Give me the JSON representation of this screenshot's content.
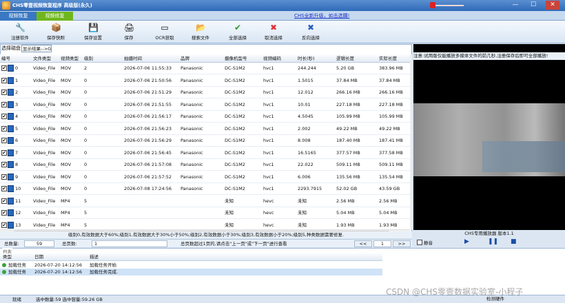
{
  "window": {
    "title": "CHS零壹视频恢复程序 高级版(永久)",
    "minimize": "—",
    "maximize": "☐",
    "close": "✕"
  },
  "tabs": [
    "视频恢复",
    "视频修复"
  ],
  "promo_link": "CHS全新升级，如击选購!",
  "toolbar": [
    {
      "label": "注册软件",
      "icon": "register-icon",
      "glyph": "🔧"
    },
    {
      "label": "保存快照",
      "icon": "snapshot-icon",
      "glyph": "📦"
    },
    {
      "label": "保存设置",
      "icon": "settings-save-icon",
      "glyph": "💾"
    },
    {
      "label": "保存",
      "icon": "save-icon",
      "glyph": "🖨"
    },
    {
      "label": "OCR获取",
      "icon": "ocr-icon",
      "glyph": "▭"
    },
    {
      "label": "搜索文件",
      "icon": "search-file-icon",
      "glyph": "📂"
    },
    {
      "label": "全部选择",
      "icon": "select-all-icon",
      "glyph": "✔"
    },
    {
      "label": "取消选择",
      "icon": "deselect-icon",
      "glyph": "✖"
    },
    {
      "label": "反向选择",
      "icon": "invert-select-icon",
      "glyph": "✖"
    }
  ],
  "left": {
    "disk_tab": "选择磁盘",
    "path_value": "显示结果-->G:"
  },
  "columns": [
    "编号",
    "文件类型",
    "视频类型",
    "级别",
    "拍摄时间",
    "品牌",
    "摄像机型号",
    "视频编码",
    "时长(秒)",
    "逻辑长度",
    "实际长度"
  ],
  "rows": [
    {
      "id": "0",
      "ftype": "Video_File",
      "vtype": "MOV",
      "level": "2",
      "time": "2026-07-06 11:55:33",
      "brand": "Panasonic",
      "model": "DC-S1M2",
      "codec": "hvc1",
      "duration": "244.244",
      "logical": "5.20 GB",
      "actual": "383.96 MB"
    },
    {
      "id": "1",
      "ftype": "Video_File",
      "vtype": "MOV",
      "level": "0",
      "time": "2026-07-06 21:50:56",
      "brand": "Panasonic",
      "model": "DC-S1M2",
      "codec": "hvc1",
      "duration": "1.5015",
      "logical": "37.84 MB",
      "actual": "37.84 MB"
    },
    {
      "id": "2",
      "ftype": "Video_File",
      "vtype": "MOV",
      "level": "0",
      "time": "2026-07-06 21:51:29",
      "brand": "Panasonic",
      "model": "DC-S1M2",
      "codec": "hvc1",
      "duration": "12.012",
      "logical": "266.16 MB",
      "actual": "266.16 MB"
    },
    {
      "id": "3",
      "ftype": "Video_File",
      "vtype": "MOV",
      "level": "0",
      "time": "2026-07-06 21:51:55",
      "brand": "Panasonic",
      "model": "DC-S1M2",
      "codec": "hvc1",
      "duration": "10.01",
      "logical": "227.18 MB",
      "actual": "227.18 MB"
    },
    {
      "id": "4",
      "ftype": "Video_File",
      "vtype": "MOV",
      "level": "0",
      "time": "2026-07-06 21:56:17",
      "brand": "Panasonic",
      "model": "DC-S1M2",
      "codec": "hvc1",
      "duration": "4.5045",
      "logical": "105.99 MB",
      "actual": "105.99 MB"
    },
    {
      "id": "5",
      "ftype": "Video_File",
      "vtype": "MOV",
      "level": "0",
      "time": "2026-07-06 21:56:23",
      "brand": "Panasonic",
      "model": "DC-S1M2",
      "codec": "hvc1",
      "duration": "2.002",
      "logical": "49.22 MB",
      "actual": "49.22 MB"
    },
    {
      "id": "6",
      "ftype": "Video_File",
      "vtype": "MOV",
      "level": "0",
      "time": "2026-07-06 21:56:29",
      "brand": "Panasonic",
      "model": "DC-S1M2",
      "codec": "hvc1",
      "duration": "8.008",
      "logical": "187.40 MB",
      "actual": "187.41 MB"
    },
    {
      "id": "7",
      "ftype": "Video_File",
      "vtype": "MOV",
      "level": "0",
      "time": "2026-07-06 21:56:45",
      "brand": "Panasonic",
      "model": "DC-S1M2",
      "codec": "hvc1",
      "duration": "16.5165",
      "logical": "377.57 MB",
      "actual": "377.58 MB"
    },
    {
      "id": "8",
      "ftype": "Video_File",
      "vtype": "MOV",
      "level": "0",
      "time": "2026-07-06 21:57:08",
      "brand": "Panasonic",
      "model": "DC-S1M2",
      "codec": "hvc1",
      "duration": "22.022",
      "logical": "509.11 MB",
      "actual": "509.11 MB"
    },
    {
      "id": "9",
      "ftype": "Video_File",
      "vtype": "MOV",
      "level": "0",
      "time": "2026-07-06 21:57:52",
      "brand": "Panasonic",
      "model": "DC-S1M2",
      "codec": "hvc1",
      "duration": "6.006",
      "logical": "135.56 MB",
      "actual": "135.54 MB"
    },
    {
      "id": "10",
      "ftype": "Video_File",
      "vtype": "MOV",
      "level": "0",
      "time": "2026-07-08 17:24:56",
      "brand": "Panasonic",
      "model": "DC-S1M2",
      "codec": "hvc1",
      "duration": "2293.7915",
      "logical": "52.02 GB",
      "actual": "43.59 GB"
    },
    {
      "id": "11",
      "ftype": "Video_File",
      "vtype": "MP4",
      "level": "5",
      "time": "",
      "brand": "",
      "model": "未知",
      "codec": "hevc",
      "duration": "未知",
      "logical": "2.56 MB",
      "actual": "2.56 MB"
    },
    {
      "id": "12",
      "ftype": "Video_File",
      "vtype": "MP4",
      "level": "5",
      "time": "",
      "brand": "",
      "model": "未知",
      "codec": "hevc",
      "duration": "未知",
      "logical": "5.04 MB",
      "actual": "5.04 MB"
    },
    {
      "id": "13",
      "ftype": "Video_File",
      "vtype": "MP4",
      "level": "5",
      "time": "",
      "brand": "",
      "model": "未知",
      "codec": "hevc",
      "duration": "未知",
      "logical": "1.93 MB",
      "actual": "1.93 MB"
    }
  ],
  "level_note": "级别0,有效数据大于60%;级别1,有效数据大于30%小于50%;级别2,有效数据小于30%;级别3,有效数据小于20%;级别5,种类数据需要修复.",
  "status_row": {
    "total_label": "总数量:",
    "total_value": "59",
    "pages_label": "总页数:",
    "pages_value": "1",
    "hint": "总页数超过1页的,请点击\"上一页\"或\"下一页\"进行查看",
    "prev": "<<",
    "page_value": "1",
    "next": ">>"
  },
  "player": {
    "notice": "注意:试用版仅能播放多媒体文件的前几秒,注册保存后即可全部播放!",
    "title": "CHS专用播放器 版本1.1",
    "mute_label": "静音"
  },
  "log": {
    "label": "日志",
    "columns": [
      "类型",
      "日期",
      "描述"
    ],
    "rows": [
      {
        "type": "加载任务",
        "date": "2026-07-20 14:12:56",
        "desc": "加载任务开始"
      },
      {
        "type": "加载任务",
        "date": "2026-07-20 14:12:56",
        "desc": "加载任务完成."
      }
    ]
  },
  "statusbar": {
    "ready": "就绪",
    "selection": "选中数量:59 选中容量:59.26 GB",
    "tray": "检测硬件"
  },
  "watermark": "CSDN @CHS零壹数据实验室-小程子"
}
